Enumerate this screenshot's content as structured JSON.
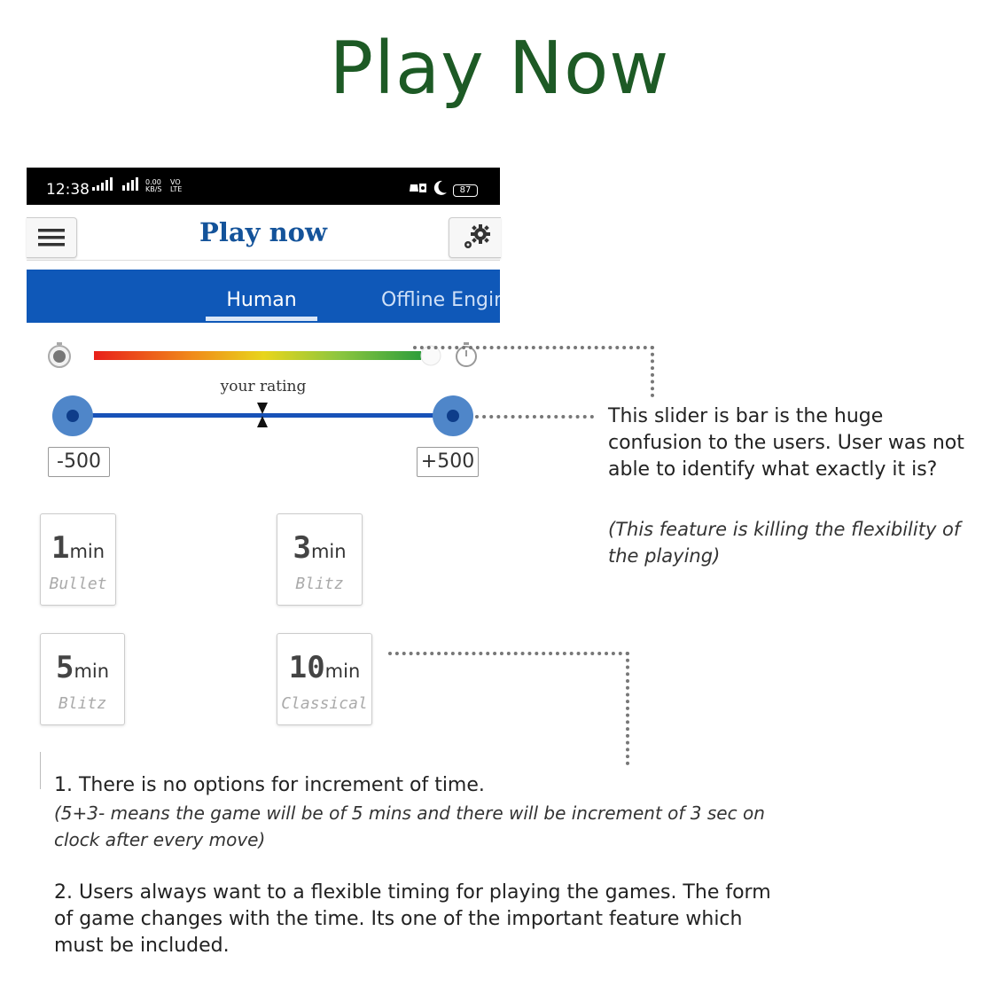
{
  "page_title": "Play Now",
  "phone": {
    "status_bar": {
      "time": "12:38",
      "net_speed": "0.00 KB/S",
      "volte": "VO LTE",
      "battery": "87"
    },
    "header": {
      "title": "Play now"
    },
    "tabs": [
      {
        "label": "Human",
        "selected": true
      },
      {
        "label": "Offline Engin",
        "selected": false
      }
    ],
    "rating": {
      "label": "your rating",
      "min_label": "-500",
      "max_label": "+500"
    },
    "time_controls": [
      {
        "digit": "1",
        "unit": "min",
        "type": "Bullet"
      },
      {
        "digit": "3",
        "unit": "min",
        "type": "Blitz"
      },
      {
        "digit": "5",
        "unit": "min",
        "type": "Blitz"
      },
      {
        "digit": "10",
        "unit": "min",
        "type": "Classical"
      }
    ]
  },
  "annotations": {
    "slider_note": "This slider is bar is the huge confusion to the users. User was not able to identify what exactly it is?",
    "slider_subnote": "(This feature is killing the flexibility of the playing)",
    "time_note_1": "1. There is no options for increment of time.",
    "time_note_1_sub": "(5+3- means the game will be of 5 mins and there will be increment of 3 sec on clock after every move)",
    "time_note_2": "2. Users always want to a flexible timing for playing the games. The form of game changes with the time. Its one of the important feature which must be included."
  },
  "colors": {
    "title_green": "#1d5a25",
    "brand_blue": "#14539a",
    "tab_blue": "#0f58b8",
    "slider_blue": "#1852b8"
  }
}
